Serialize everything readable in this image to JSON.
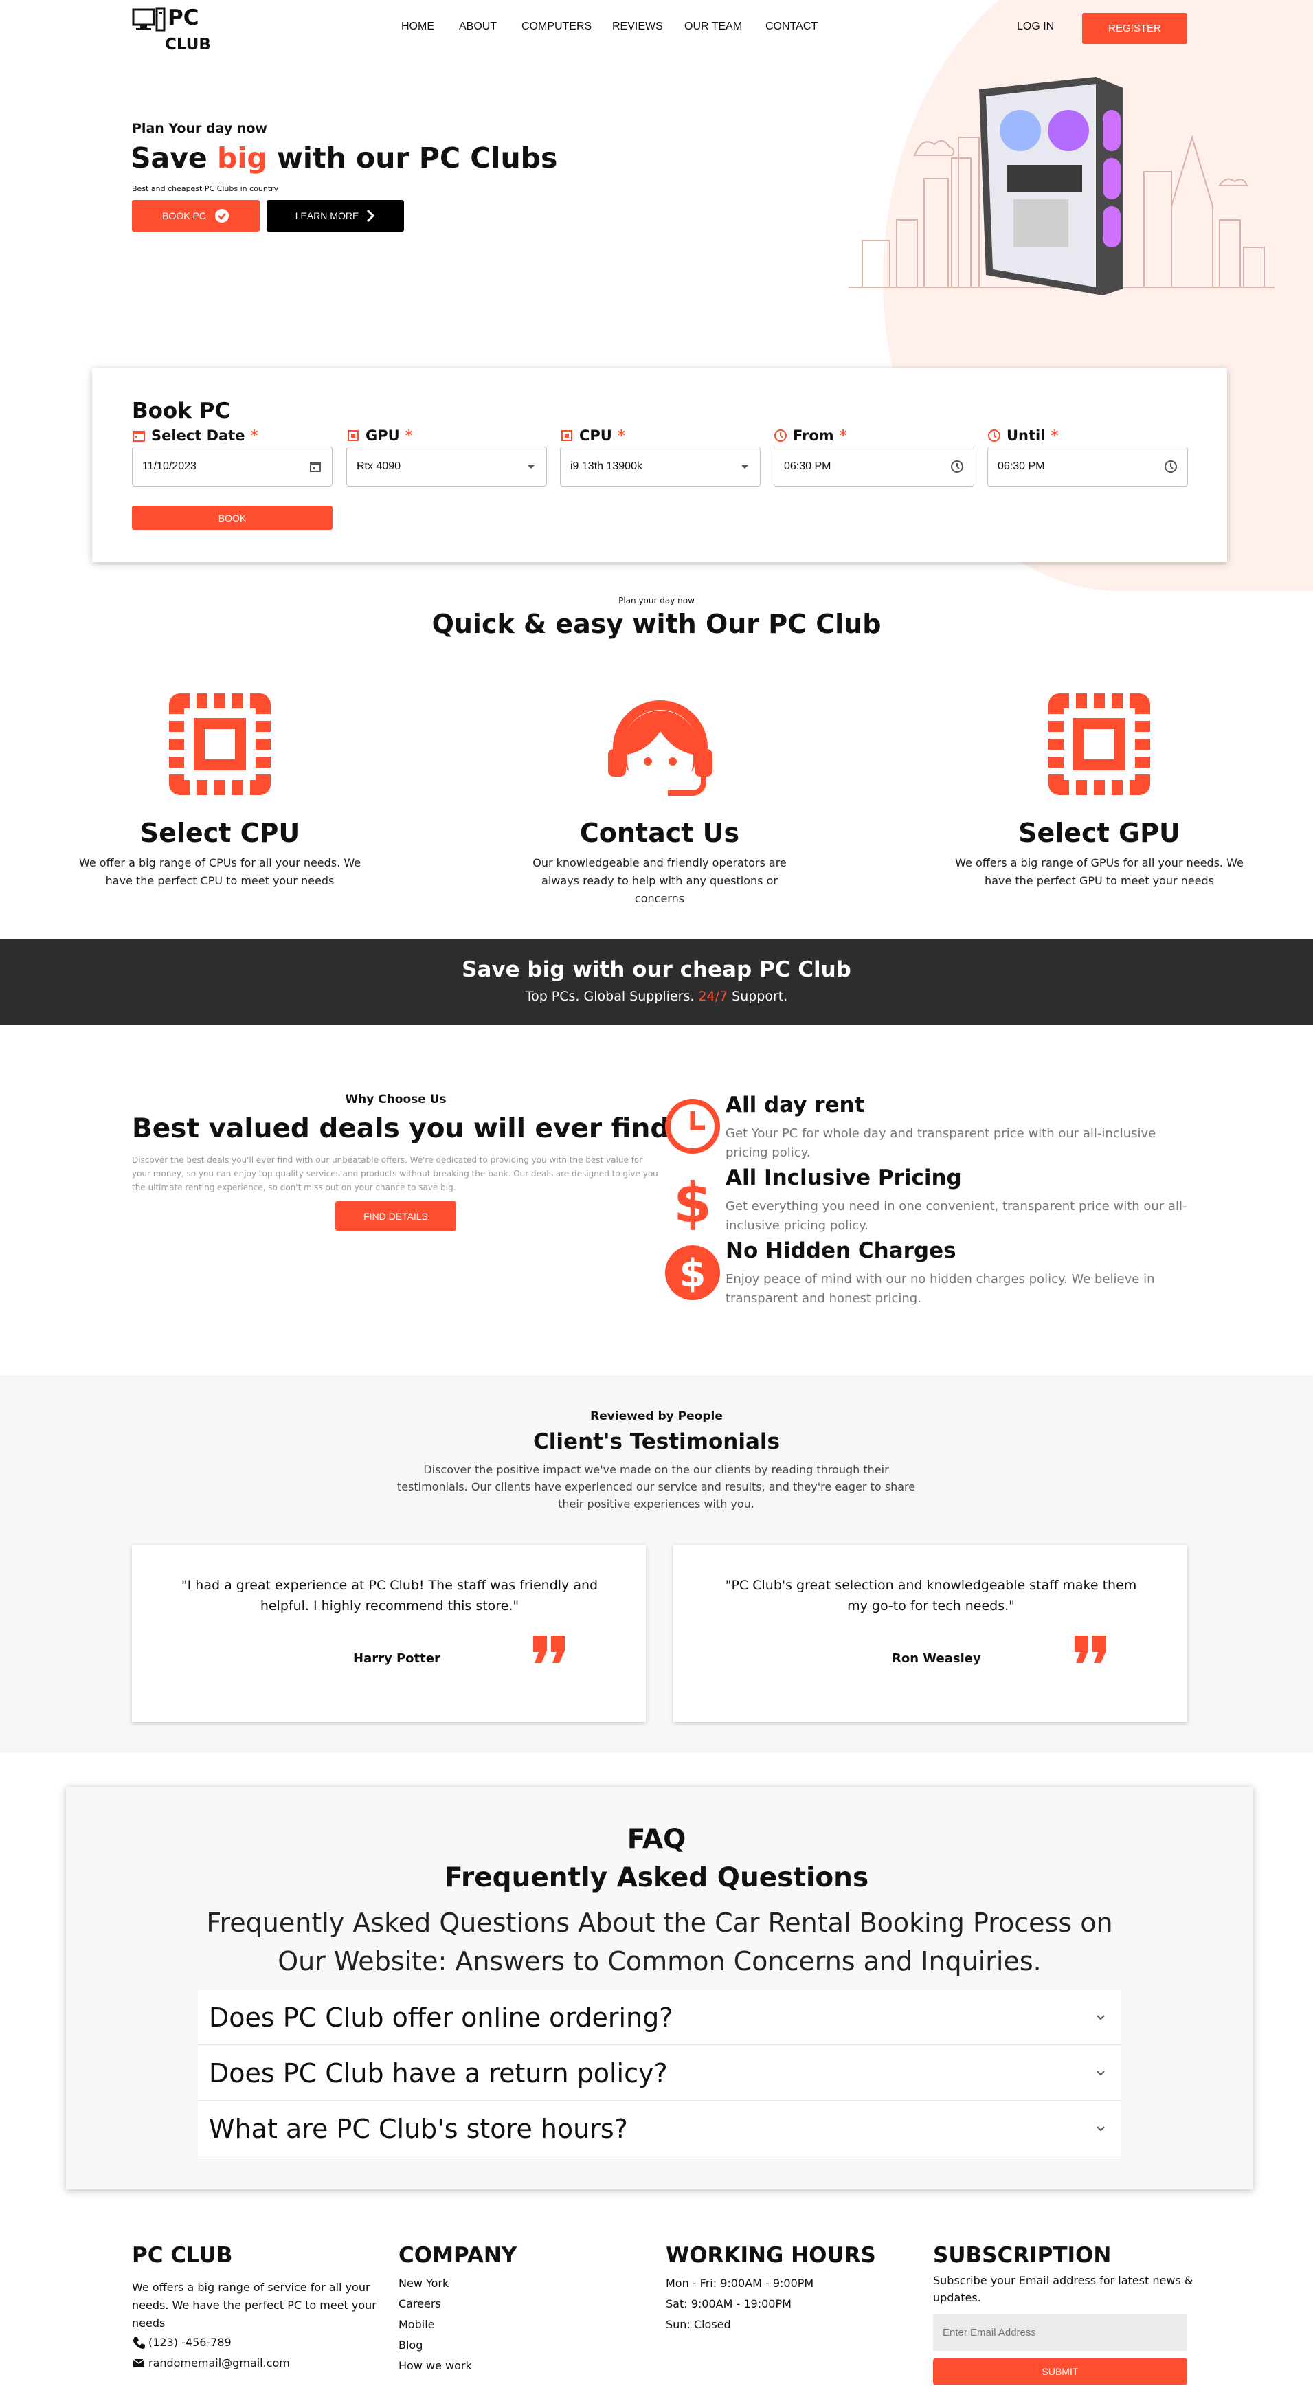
{
  "brand": {
    "line1": "PC",
    "line2": "CLUB"
  },
  "nav": {
    "items": [
      "HOME",
      "ABOUT",
      "COMPUTERS",
      "REVIEWS",
      "OUR TEAM",
      "CONTACT"
    ],
    "login": "LOG IN",
    "register": "REGISTER"
  },
  "hero": {
    "kicker": "Plan Your day now",
    "title_pre": "Save ",
    "title_accent": "big",
    "title_post": " with our PC Clubs",
    "subtitle": "Best and cheapest PC Clubs in country",
    "book_btn": "BOOK PC",
    "learn_btn": "LEARN MORE"
  },
  "booking": {
    "title": "Book PC",
    "fields": [
      {
        "label": "Select Date",
        "value": "11/10/2023",
        "icon": "calendar-icon"
      },
      {
        "label": "GPU",
        "value": "Rtx 4090",
        "icon": "chip-icon"
      },
      {
        "label": "CPU",
        "value": "i9 13th 13900k",
        "icon": "chip-icon"
      },
      {
        "label": "From",
        "value": "06:30 PM",
        "icon": "clock-icon"
      },
      {
        "label": "Until",
        "value": "06:30 PM",
        "icon": "clock-icon"
      }
    ],
    "required_mark": "*",
    "book_btn": "BOOK"
  },
  "features": {
    "kicker": "Plan your day now",
    "title": "Quick & easy with Our PC Club",
    "items": [
      {
        "title": "Select CPU",
        "text": "We offer a big range of CPUs for all your needs. We have the perfect CPU to meet your needs",
        "icon": "cpu-icon"
      },
      {
        "title": "Contact Us",
        "text": "Our knowledgeable and friendly operators are always ready to help with any questions or concerns",
        "icon": "headset-icon"
      },
      {
        "title": "Select GPU",
        "text": "We offers a big range of GPUs for all your needs. We have the perfect GPU to meet your needs",
        "icon": "gpu-icon"
      }
    ]
  },
  "banner": {
    "title": "Save big with our cheap PC Club",
    "sub_pre": "Top PCs. Global Suppliers. ",
    "sub_accent": "24/7",
    "sub_post": " Support."
  },
  "why": {
    "kicker": "Why Choose Us",
    "title": "Best valued deals you will ever find",
    "text": "Discover the best deals you'll ever find with our unbeatable offers. We're dedicated to providing you with the best value for your money, so you can enjoy top-quality services and products without breaking the bank. Our deals are designed to give you the ultimate renting experience, so don't miss out on your chance to save big.",
    "btn": "FIND DETAILS",
    "items": [
      {
        "title": "All day rent",
        "text": "Get Your PC for whole day and transparent price with our all-inclusive pricing policy.",
        "icon": "clock-icon"
      },
      {
        "title": "All Inclusive Pricing",
        "text": "Get everything you need in one convenient, transparent price with our all-inclusive pricing policy.",
        "icon": "dollar-icon"
      },
      {
        "title": "No Hidden Charges",
        "text": "Enjoy peace of mind with our no hidden charges policy. We believe in transparent and honest pricing.",
        "icon": "dollar-circle-icon"
      }
    ]
  },
  "testimonials": {
    "kicker": "Reviewed by People",
    "title": "Client's Testimonials",
    "text": "Discover the positive impact we've made on the our clients by reading through their testimonials. Our clients have experienced our service and results, and they're eager to share their positive experiences with you.",
    "items": [
      {
        "quote": "\"I had a great experience at PC Club! The staff was friendly and helpful. I highly recommend this store.\"",
        "name": "Harry Potter"
      },
      {
        "quote": "\"PC Club's great selection and knowledgeable staff make them my go-to for tech needs.\"",
        "name": "Ron Weasley"
      }
    ]
  },
  "faq": {
    "kicker": "FAQ",
    "title": "Frequently Asked Questions",
    "text": "Frequently Asked Questions About the Car Rental Booking Process on Our Website: Answers to Common Concerns and Inquiries.",
    "items": [
      "Does PC Club offer online ordering?",
      "Does PC Club have a return policy?",
      "What are PC Club's store hours?"
    ]
  },
  "footer": {
    "brand": {
      "title": "PC CLUB",
      "text": "We offers a big range of service for all your needs. We have the perfect PC to meet your needs",
      "phone": "(123) -456-789",
      "email": "randomemail@gmail.com"
    },
    "company": {
      "title": "COMPANY",
      "links": [
        "New York",
        "Careers",
        "Mobile",
        "Blog",
        "How we work"
      ]
    },
    "hours": {
      "title": "WORKING HOURS",
      "lines": [
        "Mon - Fri: 9:00AM - 9:00PM",
        "Sat: 9:00AM - 19:00PM",
        "Sun: Closed"
      ]
    },
    "subscription": {
      "title": "SUBSCRIPTION",
      "text": "Subscribe your Email address for latest news & updates.",
      "placeholder": "Enter Email Address",
      "btn": "SUBMIT"
    }
  },
  "colors": {
    "accent": "#ff4d30",
    "dark_banner": "#2d2d2d",
    "section_bg": "#f7f7f7"
  }
}
